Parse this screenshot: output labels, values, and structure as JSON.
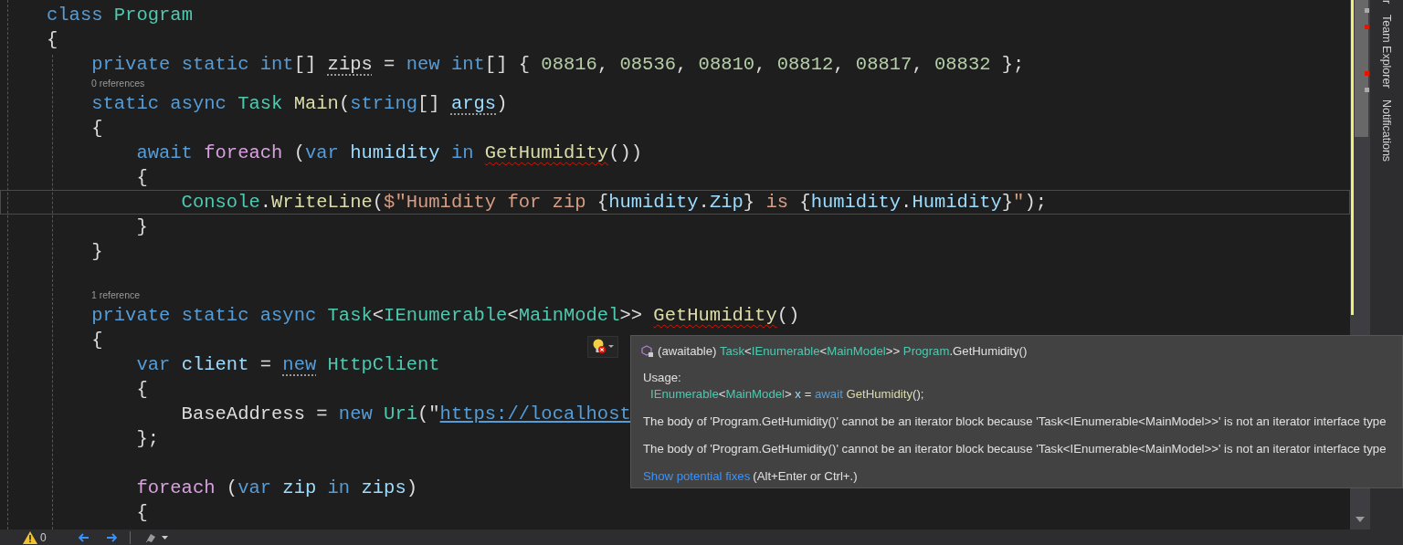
{
  "editor": {
    "lines": [
      {
        "kind": "code",
        "tokens": [
          {
            "text": "class",
            "kind": "keyword"
          },
          {
            "text": " Program",
            "kind": "type"
          }
        ]
      },
      {
        "kind": "code",
        "tokens": [
          {
            "text": "{",
            "kind": "plain"
          }
        ]
      },
      {
        "kind": "code",
        "tokens": [
          {
            "text": "    private",
            "kind": "keyword"
          },
          {
            "text": " static",
            "kind": "keyword"
          },
          {
            "text": " int",
            "kind": "keyword"
          },
          {
            "text": "[] ",
            "kind": "plain"
          },
          {
            "text": "zips",
            "kind": "plain",
            "hint": true
          },
          {
            "text": " =",
            "kind": "plain"
          },
          {
            "text": " new",
            "kind": "keyword"
          },
          {
            "text": " int",
            "kind": "keyword"
          },
          {
            "text": "[] {",
            "kind": "plain"
          },
          {
            "text": " 08816",
            "kind": "number"
          },
          {
            "text": ",",
            "kind": "plain"
          },
          {
            "text": " 08536",
            "kind": "number"
          },
          {
            "text": ",",
            "kind": "plain"
          },
          {
            "text": " 08810",
            "kind": "number"
          },
          {
            "text": ",",
            "kind": "plain"
          },
          {
            "text": " 08812",
            "kind": "number"
          },
          {
            "text": ",",
            "kind": "plain"
          },
          {
            "text": " 08817",
            "kind": "number"
          },
          {
            "text": ",",
            "kind": "plain"
          },
          {
            "text": " 08832",
            "kind": "number"
          },
          {
            "text": " };",
            "kind": "plain"
          }
        ]
      },
      {
        "kind": "codelens",
        "text": "0 references"
      },
      {
        "kind": "code",
        "tokens": [
          {
            "text": "    static",
            "kind": "keyword"
          },
          {
            "text": " async",
            "kind": "keyword"
          },
          {
            "text": " Task",
            "kind": "type"
          },
          {
            "text": " Main",
            "kind": "method"
          },
          {
            "text": "(",
            "kind": "plain"
          },
          {
            "text": "string",
            "kind": "keyword"
          },
          {
            "text": "[] ",
            "kind": "plain"
          },
          {
            "text": "args",
            "kind": "variable",
            "hint": true
          },
          {
            "text": ")",
            "kind": "plain"
          }
        ]
      },
      {
        "kind": "code",
        "tokens": [
          {
            "text": "    {",
            "kind": "plain"
          }
        ]
      },
      {
        "kind": "code",
        "tokens": [
          {
            "text": "        await",
            "kind": "keyword"
          },
          {
            "text": " foreach",
            "kind": "control"
          },
          {
            "text": " (",
            "kind": "plain"
          },
          {
            "text": "var",
            "kind": "keyword"
          },
          {
            "text": " humidity",
            "kind": "variable"
          },
          {
            "text": " in ",
            "kind": "keyword"
          },
          {
            "text": "GetHumidity",
            "kind": "method",
            "error": true
          },
          {
            "text": "())",
            "kind": "plain"
          }
        ]
      },
      {
        "kind": "code",
        "tokens": [
          {
            "text": "        {",
            "kind": "plain"
          }
        ]
      },
      {
        "kind": "code",
        "current": true,
        "tokens": [
          {
            "text": "            Console",
            "kind": "type"
          },
          {
            "text": ".",
            "kind": "plain"
          },
          {
            "text": "WriteLine",
            "kind": "method"
          },
          {
            "text": "(",
            "kind": "plain"
          },
          {
            "text": "$\"Humidity for zip ",
            "kind": "string"
          },
          {
            "text": "{",
            "kind": "plain"
          },
          {
            "text": "humidity",
            "kind": "variable"
          },
          {
            "text": ".",
            "kind": "plain"
          },
          {
            "text": "Zip",
            "kind": "variable"
          },
          {
            "text": "}",
            "kind": "plain"
          },
          {
            "text": " is ",
            "kind": "string"
          },
          {
            "text": "{",
            "kind": "plain"
          },
          {
            "text": "humidity",
            "kind": "variable"
          },
          {
            "text": ".",
            "kind": "plain"
          },
          {
            "text": "Humidity",
            "kind": "variable"
          },
          {
            "text": "}",
            "kind": "plain"
          },
          {
            "text": "\"",
            "kind": "string"
          },
          {
            "text": ");",
            "kind": "plain"
          }
        ]
      },
      {
        "kind": "code",
        "tokens": [
          {
            "text": "        }",
            "kind": "plain"
          }
        ]
      },
      {
        "kind": "code",
        "tokens": [
          {
            "text": "    }",
            "kind": "plain"
          }
        ]
      },
      {
        "kind": "blank"
      },
      {
        "kind": "codelens",
        "text": "1 reference"
      },
      {
        "kind": "code",
        "tokens": [
          {
            "text": "    private",
            "kind": "keyword"
          },
          {
            "text": " static",
            "kind": "keyword"
          },
          {
            "text": " async",
            "kind": "keyword"
          },
          {
            "text": " Task",
            "kind": "type"
          },
          {
            "text": "<",
            "kind": "plain"
          },
          {
            "text": "IEnumerable",
            "kind": "type"
          },
          {
            "text": "<",
            "kind": "plain"
          },
          {
            "text": "MainModel",
            "kind": "type"
          },
          {
            "text": ">> ",
            "kind": "plain"
          },
          {
            "text": "GetHumidity",
            "kind": "method",
            "error": true
          },
          {
            "text": "()",
            "kind": "plain"
          }
        ]
      },
      {
        "kind": "code",
        "tokens": [
          {
            "text": "    {",
            "kind": "plain"
          }
        ]
      },
      {
        "kind": "code",
        "tokens": [
          {
            "text": "        var",
            "kind": "keyword"
          },
          {
            "text": " client",
            "kind": "variable"
          },
          {
            "text": " = ",
            "kind": "plain"
          },
          {
            "text": "new",
            "kind": "keyword",
            "hint": true
          },
          {
            "text": " HttpClient",
            "kind": "type"
          }
        ]
      },
      {
        "kind": "code",
        "tokens": [
          {
            "text": "        {",
            "kind": "plain"
          }
        ]
      },
      {
        "kind": "code",
        "tokens": [
          {
            "text": "            BaseAddress =",
            "kind": "plain"
          },
          {
            "text": " new",
            "kind": "keyword"
          },
          {
            "text": " Uri",
            "kind": "type"
          },
          {
            "text": "(\"",
            "kind": "plain"
          },
          {
            "text": "https://localhost",
            "kind": "link"
          }
        ]
      },
      {
        "kind": "code",
        "tokens": [
          {
            "text": "        };",
            "kind": "plain"
          }
        ]
      },
      {
        "kind": "blank"
      },
      {
        "kind": "code",
        "tokens": [
          {
            "text": "        foreach",
            "kind": "control"
          },
          {
            "text": " (",
            "kind": "plain"
          },
          {
            "text": "var",
            "kind": "keyword"
          },
          {
            "text": " zip",
            "kind": "variable"
          },
          {
            "text": " in",
            "kind": "keyword"
          },
          {
            "text": " zips",
            "kind": "variable"
          },
          {
            "text": ")",
            "kind": "plain"
          }
        ]
      },
      {
        "kind": "code",
        "tokens": [
          {
            "text": "        {",
            "kind": "plain"
          }
        ]
      }
    ]
  },
  "quick_info": {
    "signature": [
      {
        "text": "(awaitable)",
        "kind": "plain"
      },
      {
        "text": " Task",
        "kind": "type"
      },
      {
        "text": "<",
        "kind": "plain"
      },
      {
        "text": "IEnumerable",
        "kind": "type"
      },
      {
        "text": "<",
        "kind": "plain"
      },
      {
        "text": "MainModel",
        "kind": "type"
      },
      {
        "text": ">>",
        "kind": "plain"
      },
      {
        "text": " Program",
        "kind": "type"
      },
      {
        "text": ".GetHumidity()",
        "kind": "plain"
      }
    ],
    "usage_label": "Usage:",
    "usage": [
      {
        "text": "IEnumerable",
        "kind": "type"
      },
      {
        "text": "<",
        "kind": "plain"
      },
      {
        "text": "MainModel",
        "kind": "type"
      },
      {
        "text": ">",
        "kind": "plain"
      },
      {
        "text": " x",
        "kind": "variable"
      },
      {
        "text": " =",
        "kind": "plain"
      },
      {
        "text": " await",
        "kind": "keyword"
      },
      {
        "text": " GetHumidity",
        "kind": "method"
      },
      {
        "text": "();",
        "kind": "plain"
      }
    ],
    "errors": [
      "The body of 'Program.GetHumidity()' cannot be an iterator block because 'Task<IEnumerable<MainModel>>' is not an iterator interface type",
      "The body of 'Program.GetHumidity()' cannot be an iterator block because 'Task<IEnumerable<MainModel>>' is not an iterator interface type"
    ],
    "fix_link": "Show potential fixes",
    "fix_shortcut": "(Alt+Enter or Ctrl+.)"
  },
  "side_tabs": [
    "r",
    "Team Explorer",
    "Notifications"
  ],
  "status_bar": {
    "warnings": "0"
  }
}
